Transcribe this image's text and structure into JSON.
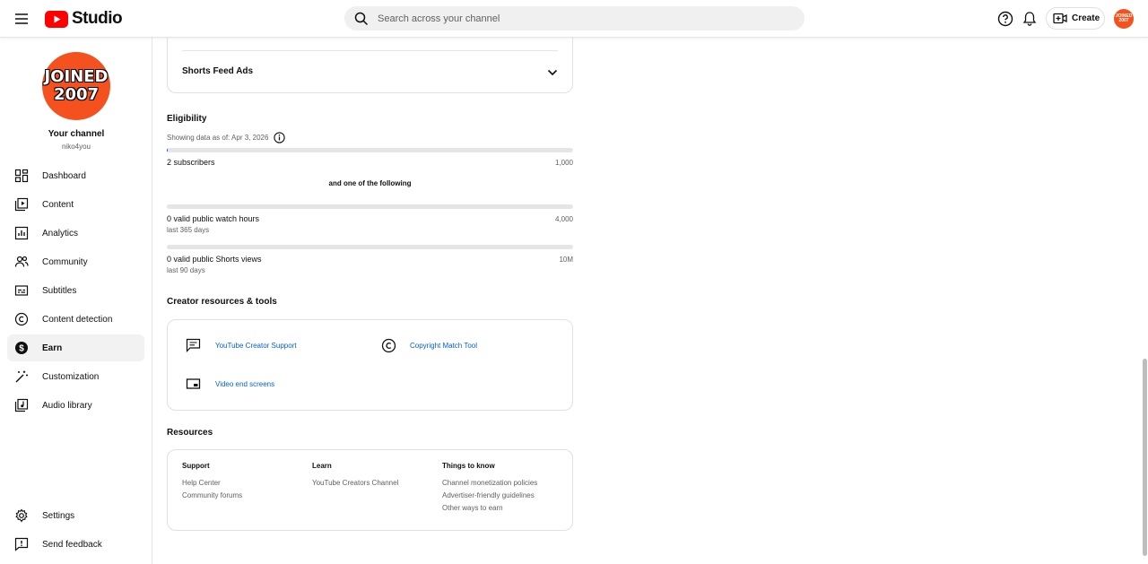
{
  "header": {
    "logo_text": "Studio",
    "search_placeholder": "Search across your channel",
    "create_label": "Create",
    "avatar_line1": "JOINED",
    "avatar_line2": "2007"
  },
  "sidebar": {
    "avatar_line1": "JOINED",
    "avatar_line2": "2007",
    "channel_title": "Your channel",
    "channel_handle": "niko4you",
    "items": [
      {
        "label": "Dashboard",
        "icon": "dashboard-icon"
      },
      {
        "label": "Content",
        "icon": "content-icon"
      },
      {
        "label": "Analytics",
        "icon": "analytics-icon"
      },
      {
        "label": "Community",
        "icon": "community-icon"
      },
      {
        "label": "Subtitles",
        "icon": "subtitles-icon"
      },
      {
        "label": "Content detection",
        "icon": "copyright-icon"
      },
      {
        "label": "Earn",
        "icon": "dollar-icon"
      },
      {
        "label": "Customization",
        "icon": "magic-wand-icon"
      },
      {
        "label": "Audio library",
        "icon": "audio-library-icon"
      }
    ],
    "settings_label": "Settings",
    "feedback_label": "Send feedback",
    "active_color": "#f2f2f2"
  },
  "main": {
    "shorts_feed_ads": "Shorts Feed Ads",
    "eligibility": {
      "title": "Eligibility",
      "data_as_of": "Showing data as of: Apr 3, 2026",
      "subscribers_label": "2 subscribers",
      "subscribers_target": "1,000",
      "subscribers_progress": 0.002,
      "one_of_following": "and one of the following",
      "watch_hours_label": "0 valid public watch hours",
      "watch_hours_period": "last 365 days",
      "watch_hours_target": "4,000",
      "watch_hours_progress": 0,
      "shorts_views_label": "0 valid public Shorts views",
      "shorts_views_period": "last 90 days",
      "shorts_views_target": "10M",
      "shorts_views_progress": 0
    },
    "creator_resources": {
      "title": "Creator resources & tools",
      "creator_support": "YouTube Creator Support",
      "copyright_match": "Copyright Match Tool",
      "video_end_screens": "Video end screens"
    },
    "resources": {
      "title": "Resources",
      "support_head": "Support",
      "support_links": [
        "Help Center",
        "Community forums"
      ],
      "learn_head": "Learn",
      "learn_links": [
        "YouTube Creators Channel"
      ],
      "things_head": "Things to know",
      "things_links": [
        "Channel monetization policies",
        "Advertiser-friendly guidelines",
        "Other ways to earn"
      ]
    }
  },
  "colors": {
    "brand_red": "#ff0000",
    "avatar_orange": "#f4511e",
    "link_blue": "#065fd4"
  }
}
